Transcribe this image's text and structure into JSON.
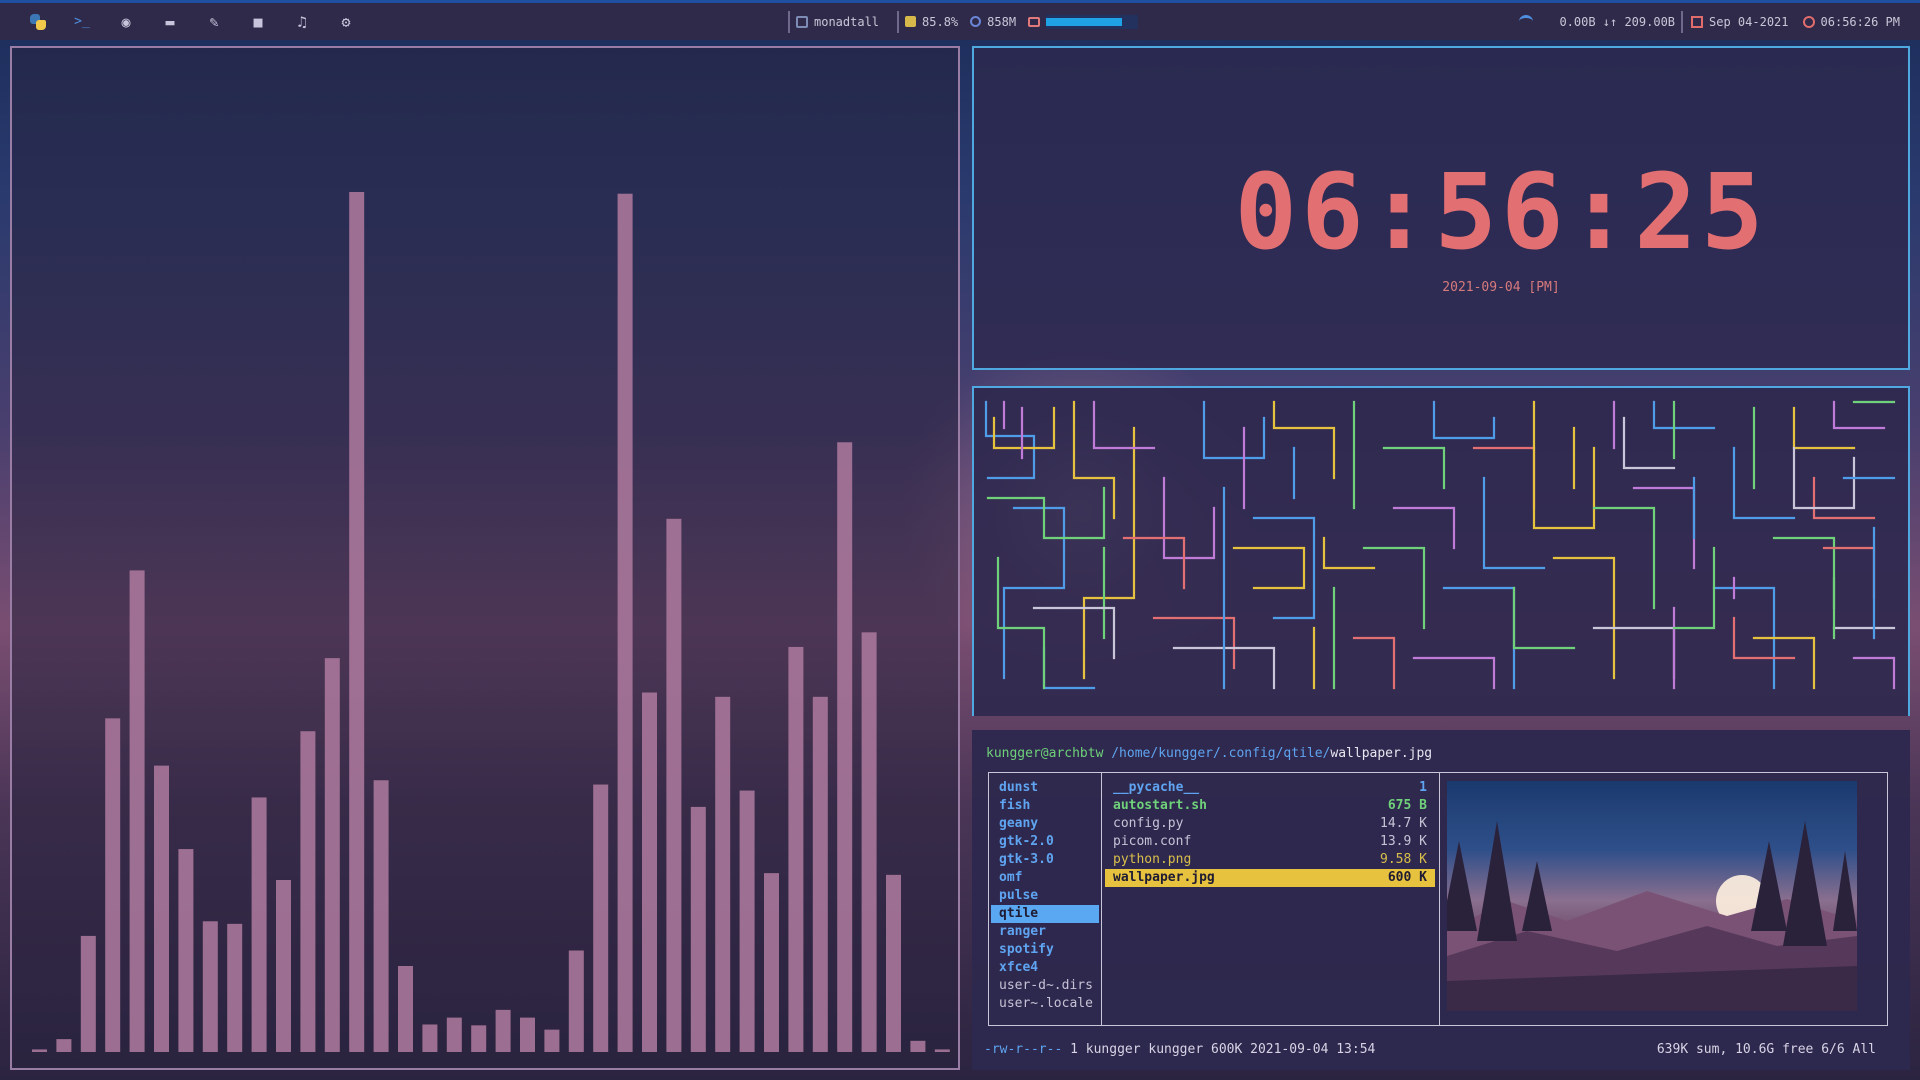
{
  "topbar": {
    "launchers": [
      {
        "name": "python-logo-icon"
      },
      {
        "name": "terminal-icon",
        "glyph": ">_"
      },
      {
        "name": "firefox-icon",
        "glyph": "◉"
      },
      {
        "name": "folder-icon",
        "glyph": "▬"
      },
      {
        "name": "editor-icon",
        "glyph": "✎"
      },
      {
        "name": "video-icon",
        "glyph": "■"
      },
      {
        "name": "music-icon",
        "glyph": "♫"
      },
      {
        "name": "settings-icon",
        "glyph": "⚙"
      }
    ],
    "layout": "monadtall",
    "memory": "85.8%",
    "cpu": "858M",
    "disk_fraction": 0.82,
    "network": "0.00B ↓↑ 209.00B",
    "date": "Sep 04-2021",
    "time": "06:56:26 PM"
  },
  "clock": {
    "time": "06:56:25",
    "date": "2021-09-04 [PM]",
    "color": "#e26f72"
  },
  "visualizer": {
    "bar_color": "#a8779a",
    "levels": [
      0.003,
      0.015,
      0.135,
      0.388,
      0.56,
      0.333,
      0.236,
      0.152,
      0.149,
      0.296,
      0.2,
      0.373,
      0.458,
      1.0,
      0.316,
      0.1,
      0.032,
      0.04,
      0.031,
      0.049,
      0.04,
      0.026,
      0.118,
      0.311,
      0.998,
      0.418,
      0.62,
      0.285,
      0.413,
      0.304,
      0.208,
      0.471,
      0.413,
      0.709,
      0.488,
      0.206,
      0.013,
      0.003
    ]
  },
  "ranger": {
    "user": "kungger@archbtw",
    "path": "/home/kungger/.config/qtile/",
    "file": "wallpaper.jpg",
    "parent_dirs": [
      {
        "name": "dunst",
        "kind": "dir"
      },
      {
        "name": "fish",
        "kind": "dir"
      },
      {
        "name": "geany",
        "kind": "dir"
      },
      {
        "name": "gtk-2.0",
        "kind": "dir"
      },
      {
        "name": "gtk-3.0",
        "kind": "dir"
      },
      {
        "name": "omf",
        "kind": "dir"
      },
      {
        "name": "pulse",
        "kind": "dir"
      },
      {
        "name": "qtile",
        "kind": "sel"
      },
      {
        "name": "ranger",
        "kind": "dir"
      },
      {
        "name": "spotify",
        "kind": "dir"
      },
      {
        "name": "xfce4",
        "kind": "dir"
      },
      {
        "name": "user-d~.dirs",
        "kind": "plain"
      },
      {
        "name": "user~.locale",
        "kind": "plain"
      }
    ],
    "files": [
      {
        "name": "__pycache__",
        "size": "1",
        "kind": "dir"
      },
      {
        "name": "autostart.sh",
        "size": "675 B",
        "kind": "exec"
      },
      {
        "name": "config.py",
        "size": "14.7 K",
        "kind": "plain"
      },
      {
        "name": "picom.conf",
        "size": "13.9 K",
        "kind": "plain"
      },
      {
        "name": "python.png",
        "size": "9.58 K",
        "kind": "img"
      },
      {
        "name": "wallpaper.jpg",
        "size": "600 K",
        "kind": "sel"
      }
    ],
    "status_perms": "-rw-r--r--",
    "status_info": "1 kungger kungger 600K 2021-09-04 13:54",
    "status_right": "639K sum, 10.6G free  6/6  All"
  }
}
